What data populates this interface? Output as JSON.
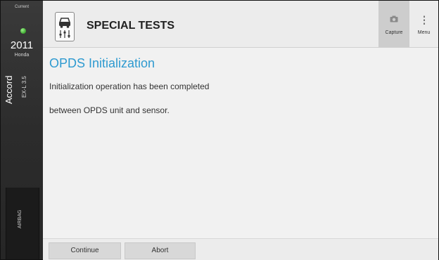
{
  "sidebar": {
    "status": "Current",
    "year": "2011",
    "make": "Honda",
    "model": "Accord",
    "trim": "EX-L 3.5",
    "system": "AIRBAG",
    "status_color": "#3aa62c"
  },
  "header": {
    "title": "SPECIAL TESTS",
    "icon": "car-test-icon",
    "capture_label": "Capture",
    "menu_label": "Menu"
  },
  "content": {
    "section_title": "OPDS Initialization",
    "line1": "Initialization operation has been completed",
    "line2": "between OPDS unit and sensor."
  },
  "footer": {
    "continue_label": "Continue",
    "abort_label": "Abort"
  },
  "colors": {
    "accent": "#2e9ad0",
    "sidebar_bg": "#2c2c2c",
    "content_bg": "#f1f1f1"
  }
}
